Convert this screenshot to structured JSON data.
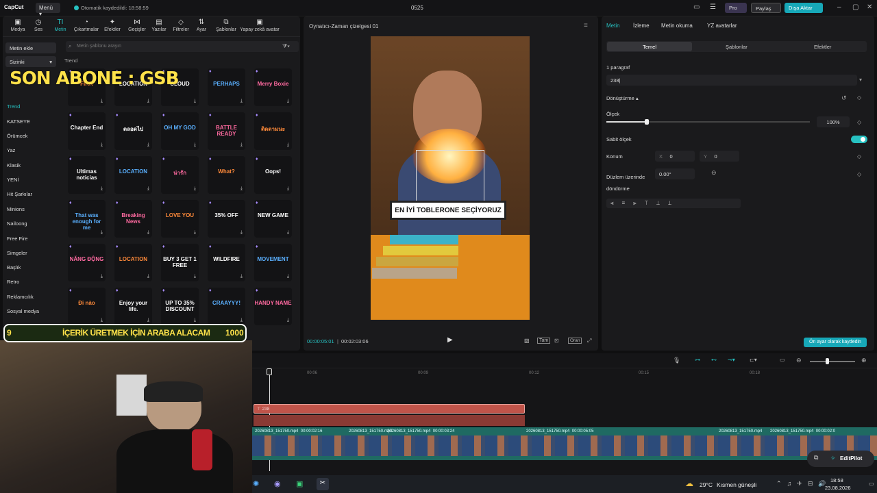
{
  "titlebar": {
    "app_name": "CapCut",
    "menu_label": "Menü",
    "save_status": "Otomatik kaydedildi: 18:58:59",
    "project_name": "0525",
    "pro_label": "Pro",
    "share_label": "Paylaş",
    "export_label": "Dışa Aktar"
  },
  "toolbar": {
    "tools": [
      "Medya",
      "Ses",
      "Metin",
      "Çıkartmalar",
      "Efektler",
      "Geçişler",
      "Yazılar",
      "Filtreler",
      "Ayar",
      "Şablonlar",
      "Yapay zekâ avatar"
    ]
  },
  "sidebar": {
    "add_text": "Metin ekle",
    "group": "Sizinki",
    "items": [
      "Trend",
      "KATSEYE",
      "Örümcek",
      "Yaz",
      "Klasik",
      "YENİ",
      "Hit Şarkılar",
      "Minions",
      "Nailoong",
      "Free Fire",
      "Simgeler",
      "Başlık",
      "Retro",
      "Reklamcılık",
      "Sosyal medya"
    ]
  },
  "search": {
    "placeholder": "Metin şablonu arayın"
  },
  "section_title": "Trend",
  "templates": [
    [
      "FIKR",
      "LOCATION",
      "CLOUD",
      "PERHAPS",
      "Merry Boxie"
    ],
    [
      "Chapter End",
      "ตลอดไป",
      "OH MY GOD",
      "BATTLE READY",
      "ติดตามนะ"
    ],
    [
      "Ultimas noticias",
      "LOCATION",
      "น่ารัก",
      "What?",
      "Oops!"
    ],
    [
      "That was enough for me",
      "Breaking News",
      "LOVE YOU",
      "35% OFF",
      "NEW GAME"
    ],
    [
      "NĂNG ĐỘNG",
      "LOCATION",
      "BUY 3 GET 1 FREE",
      "WILDFIRE",
      "MOVEMENT"
    ],
    [
      "Đi nào",
      "Enjoy your life.",
      "UP TO 35% DISCOUNT",
      "CRAAYYY!",
      "HANDY NAME"
    ]
  ],
  "player": {
    "title": "Oynatıcı-Zaman çizelgesi 01",
    "caption": "EN İYİ TOBLERONE SEÇİYORUZ",
    "current_time": "00:00:05:01",
    "total_time": "00:02:03:06",
    "full_label": "Tam",
    "ratio_label": "Oran"
  },
  "right": {
    "tabs": [
      "Metin",
      "İzleme",
      "Metin okuma",
      "YZ avatarlar"
    ],
    "subtabs": [
      "Temel",
      "Şablonlar",
      "Efektler"
    ],
    "paragraph_label": "1 paragraf",
    "text_value": "238",
    "transform_label": "Dönüştürme",
    "scale_label": "Ölçek",
    "scale_value": "100%",
    "scale_fraction": 0.2,
    "uniform_label": "Sabit ölçek",
    "position_label": "Konum",
    "x_label": "X",
    "x_value": "0",
    "y_label": "Y",
    "y_value": "0",
    "rotate_label": "Düzlem üzerinde döndürme",
    "rotate_value": "0.00°",
    "default_button": "Ön ayar olarak kaydedin"
  },
  "overlay": {
    "abone_text": "SON ABONE : GSB",
    "goal_left": "9",
    "goal_text": "İÇERİK ÜRETMEK İÇİN ARABA ALACAM",
    "goal_right": "1000"
  },
  "timeline": {
    "ruler": [
      "00:06",
      "00:09",
      "00:12",
      "00:15",
      "00:18"
    ],
    "text_clip": "238",
    "clips": [
      {
        "name": "20260813_151750.mp4",
        "dur": "00:00:02:16"
      },
      {
        "name": "20260813_151750.mp4",
        "dur": ""
      },
      {
        "name": "20260813_151750.mp4",
        "dur": "00:00:03:24"
      },
      {
        "name": "20260813_151750.mp4",
        "dur": "00:00:05:05"
      },
      {
        "name": "20260813_151750.mp4",
        "dur": ""
      },
      {
        "name": "20260813_151750.mp4",
        "dur": "00:00:02:0"
      }
    ],
    "editpilot": "EditPilot"
  },
  "taskbar": {
    "weather_temp": "29°C",
    "weather_text": "Kısmen güneşli",
    "time": "18:58",
    "date": "23.08.2026"
  },
  "colors": {
    "accent": "#27c1c1",
    "text_clip": "#c0544a",
    "video_track": "#1f6a62",
    "goal_text": "#ffe24a"
  }
}
